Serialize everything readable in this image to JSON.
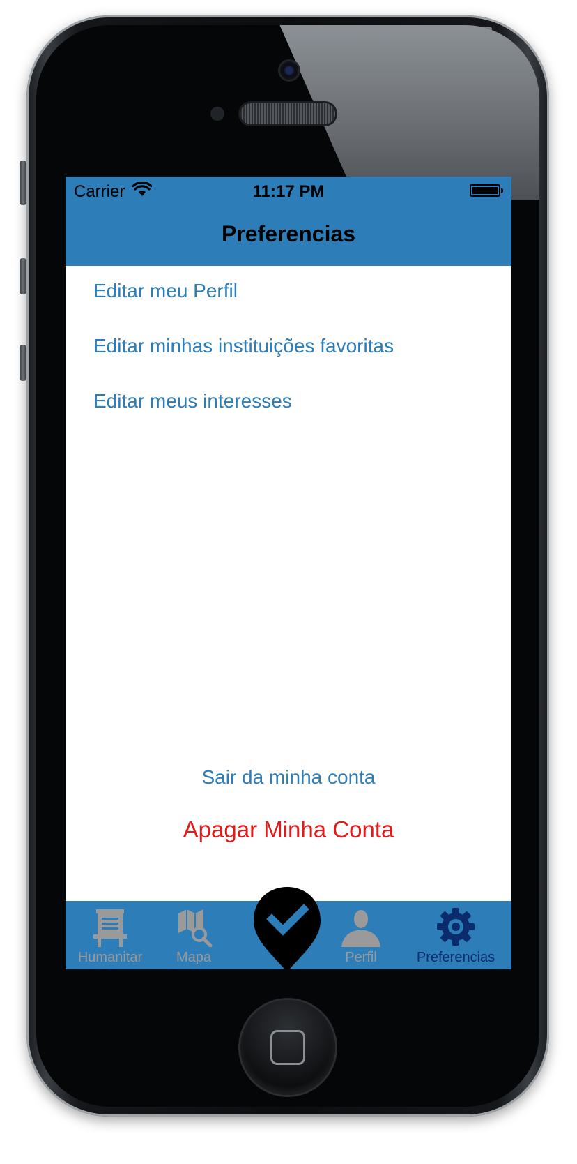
{
  "status_bar": {
    "carrier": "Carrier",
    "time": "11:17 PM"
  },
  "nav": {
    "title": "Preferencias"
  },
  "menu": {
    "items": [
      {
        "label": "Editar meu Perfil"
      },
      {
        "label": "Editar minhas instituições favoritas"
      },
      {
        "label": "Editar meus interesses"
      }
    ]
  },
  "actions": {
    "logout": "Sair da minha conta",
    "delete_account": "Apagar Minha Conta"
  },
  "tabbar": {
    "tabs": [
      {
        "label": "Humanitar",
        "icon": "easel-icon",
        "active": false
      },
      {
        "label": "Mapa",
        "icon": "map-search-icon",
        "active": false
      },
      {
        "label": "",
        "icon": "map-pin-check-icon",
        "active": false
      },
      {
        "label": "Perfil",
        "icon": "person-icon",
        "active": false
      },
      {
        "label": "Preferencias",
        "icon": "gear-icon",
        "active": true
      }
    ]
  },
  "colors": {
    "primary": "#2c7db8",
    "danger": "#e21a1a",
    "active_tab": "#0b2c6c",
    "inactive_tab": "#9a9a9a"
  }
}
